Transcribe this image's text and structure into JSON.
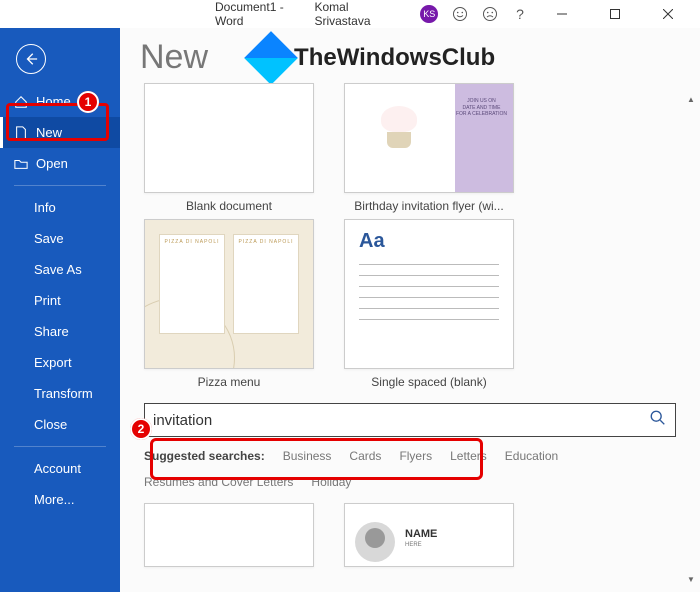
{
  "titlebar": {
    "doc": "Document1  -  Word",
    "user": "Komal Srivastava",
    "badge": "KS"
  },
  "sidebar": {
    "home": "Home",
    "new": "New",
    "open": "Open",
    "info": "Info",
    "save": "Save",
    "saveas": "Save As",
    "print": "Print",
    "share": "Share",
    "export": "Export",
    "transform": "Transform",
    "close": "Close",
    "account": "Account",
    "more": "More..."
  },
  "header": {
    "title": "New",
    "brand": "TheWindowsClub"
  },
  "templates": {
    "blank": "Blank document",
    "birthday": "Birthday invitation flyer (wi...",
    "pizza": "Pizza menu",
    "pizza_hdr": "PIZZA DI NAPOLI",
    "single": "Single spaced (blank)",
    "cupcake_txt": "JOIN US ON\nDATE AND TIME\nFOR A CELEBRATION",
    "name_card": "NAME",
    "name_sub": "HERE"
  },
  "search": {
    "value": "invitation",
    "suggest_lbl": "Suggested searches:",
    "s1": "Business",
    "s2": "Cards",
    "s3": "Flyers",
    "s4": "Letters",
    "s5": "Education",
    "s6": "Resumes and Cover Letters",
    "s7": "Holiday"
  },
  "annotations": {
    "n1": "1",
    "n2": "2"
  }
}
